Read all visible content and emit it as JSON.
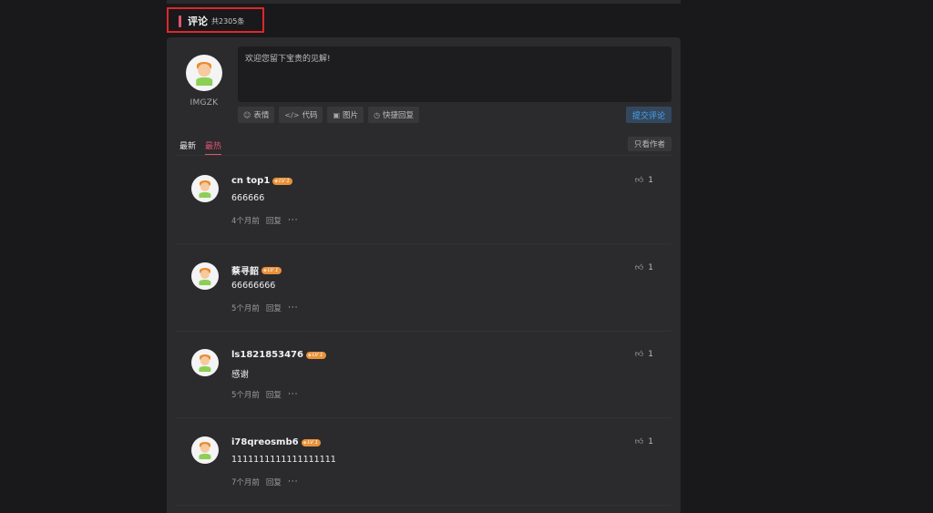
{
  "section": {
    "title": "评论",
    "count": "共2305条"
  },
  "composer": {
    "username": "IMGZK",
    "placeholder": "欢迎您留下宝贵的见解!",
    "tools": [
      {
        "icon": "☺",
        "label": "表情"
      },
      {
        "icon": "</>",
        "label": "代码"
      },
      {
        "icon": "▣",
        "label": "图片"
      },
      {
        "icon": "◷",
        "label": "快捷回复"
      }
    ],
    "submit_label": "提交评论"
  },
  "sort": {
    "tabs": [
      "最新",
      "最热"
    ],
    "active": "最热",
    "author_only_label": "只看作者"
  },
  "comments": [
    {
      "user": "cn top1",
      "level": "LV 1",
      "text": "666666",
      "time": "4个月前",
      "reply": "回复",
      "likes": "1"
    },
    {
      "user": "蔡寻韶",
      "level": "LV 1",
      "text": "66666666",
      "time": "5个月前",
      "reply": "回复",
      "likes": "1"
    },
    {
      "user": "ls1821853476",
      "level": "LV 1",
      "text": "感谢",
      "time": "5个月前",
      "reply": "回复",
      "likes": "1"
    },
    {
      "user": "i78qreosmb6",
      "level": "LV 1",
      "text": "1111111111111111111",
      "time": "7个月前",
      "reply": "回复",
      "likes": "1"
    }
  ],
  "colors": {
    "accent": "#e0536e",
    "badge": "#e8923a",
    "submit_text": "#4aa3f0",
    "panel": "#2b2b2e"
  }
}
